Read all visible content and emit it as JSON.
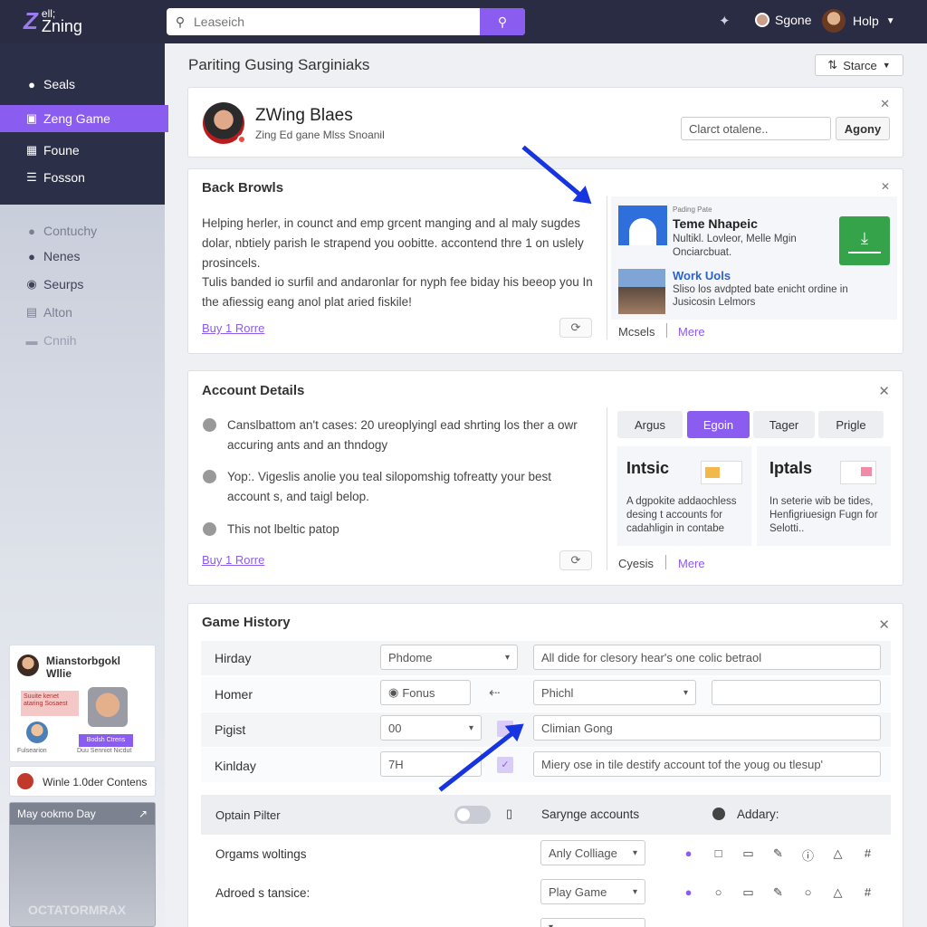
{
  "app": {
    "logo_mark": "Z",
    "logo_small": "ell;",
    "logo_text": "Zning"
  },
  "search": {
    "placeholder": "Leaseich"
  },
  "topbar": {
    "user_label": "Sgone",
    "help_label": "Holp"
  },
  "sidebar": {
    "items": [
      {
        "label": "Seals",
        "icon": "person-icon"
      },
      {
        "label": "Zeng Game",
        "icon": "game-icon"
      },
      {
        "label": "Foune",
        "icon": "calendar-icon"
      },
      {
        "label": "Fosson",
        "icon": "list-icon"
      },
      {
        "label": "Contuchy",
        "icon": "person-icon"
      },
      {
        "label": "Nenes",
        "icon": "person-icon"
      },
      {
        "label": "Seurps",
        "icon": "circle-icon"
      },
      {
        "label": "Alton",
        "icon": "image-icon"
      },
      {
        "label": "Cnnih",
        "icon": "folder-icon"
      }
    ]
  },
  "page": {
    "title": "Pariting Gusing Sarginiaks",
    "starce_label": "Starce"
  },
  "profile": {
    "name": "ZWing Blaes",
    "subtitle": "Zing Ed gane Mlss Snoanil",
    "input_value": "Clarct otalene..",
    "button_label": "Agony"
  },
  "back_browls": {
    "title": "Back Browls",
    "para1": "Helping herler, in counct and emp grcent manging and al maly sugdes dolar, nbtiely parish le strapend you oobitte. accontend thre 1 on uslely prosincels.",
    "para2": "Tulis banded io surfil and andaronlar for nyph fee biday his beeop you In the afiessig eang anol plat aried fiskile!",
    "link": "Buy 1 Rorre",
    "side": {
      "header": "Pading Pate",
      "item1_title": "Teme Nhapeic",
      "item1_desc": "Nultikl. Lovleor, Melle Mgin Onciarcbuat.",
      "item2_title": "Work Uols",
      "item2_desc": "Sliso los avdpted bate enicht ordine in Jusicosin Lelmors",
      "footer_a": "Mcsels",
      "footer_b": "Mere"
    }
  },
  "account": {
    "title": "Account Details",
    "items": [
      "Canslbattom an't cases: 20 ureoplyingl ead shrting los ther a owr accuring ants and an thndogy",
      "Yop:. Vigeslis anolie you teal silopomshig tofreatty your best account s, and taigl belop.",
      "This not lbeltic patop"
    ],
    "link": "Buy 1 Rorre",
    "tabs": [
      "Argus",
      "Egoin",
      "Tager",
      "Prigle"
    ],
    "tile1_title": "Intsic",
    "tile1_desc": "A dgpokite addaochless desing t accounts for cadahligin in contabe",
    "tile2_title": "Iptals",
    "tile2_desc": "In seterie wib be tides, Henfigriuesign Fugn for Selotti..",
    "footer_a": "Cyesis",
    "footer_b": "Mere"
  },
  "history": {
    "title": "Game History",
    "rows": [
      {
        "label": "Hirday",
        "select": "Phdome",
        "text": "All dide for clesory hear's one colic betraol"
      },
      {
        "label": "Homer",
        "select": "Fonus",
        "select2": "Phichl",
        "text": ""
      },
      {
        "label": "Pigist",
        "select": "00",
        "text": "Climian Gong"
      },
      {
        "label": "Kinlday",
        "select": "7H",
        "text": "Miery ose in tile destify account tof the youg ou tlesup'"
      }
    ],
    "option_header": "Optain Pilter",
    "savings_label": "Sarynge accounts",
    "addary_label": "Addary:",
    "row_a_label": "Orgams woltings",
    "row_a_select": "Anly Colliage",
    "row_b_label": "Adroed s tansice:",
    "row_b_select": "Play Game"
  },
  "left_panels": {
    "card1_title": "Mianstorbgokl Wllie",
    "card1_sub1": "Suuite kenet ataring Sosaest",
    "card1_sub2": "Fulsearion",
    "card1_button": "Bodsh Ctrens",
    "card1_foot": "Duu Senniot Nicdut",
    "card2_title": "Winle 1.0der Contens",
    "card3_title": "May ookmo Day",
    "card3_watermark": "OCTATORMRAX"
  },
  "colors": {
    "accent": "#8a5cf0",
    "topbar": "#2a2c44",
    "arrow": "#1634e0",
    "download": "#35a34a"
  }
}
